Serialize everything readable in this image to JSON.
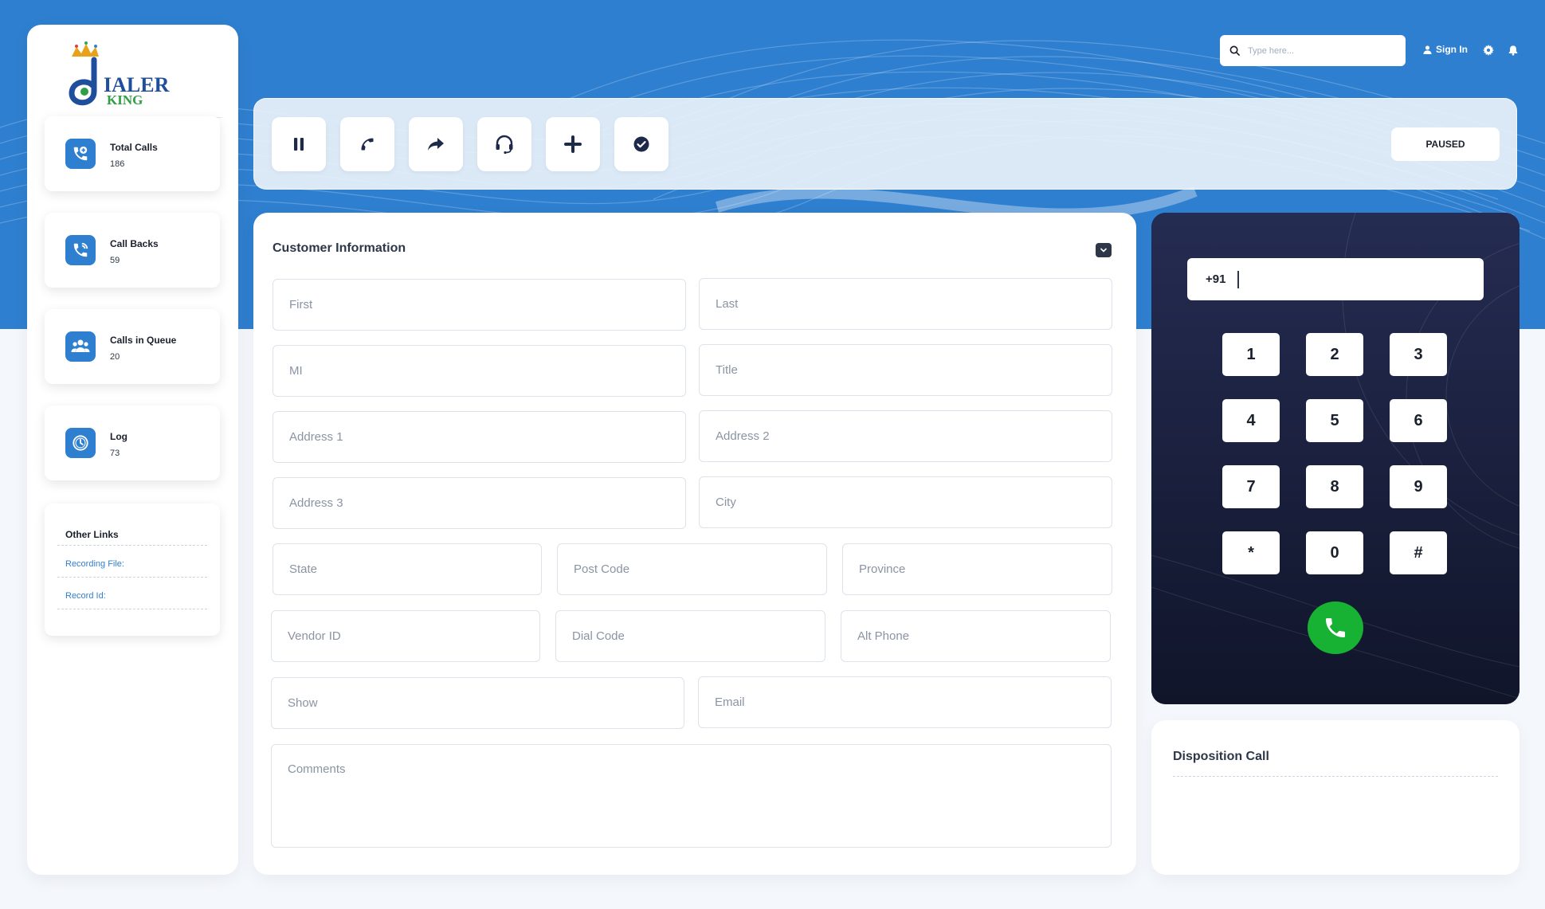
{
  "brand": {
    "logo_text_top": "IALER",
    "logo_text_bottom": "KING",
    "logo_letter": "D",
    "primary_color": "#2f7fd0",
    "call_color": "#17b233",
    "dialer_bg": "#1c2340"
  },
  "header": {
    "search_placeholder": "Type here...",
    "signin_label": "Sign In"
  },
  "sidebar": {
    "stats": [
      {
        "label": "Total Calls",
        "value": "186",
        "icon": "phone-plus-icon"
      },
      {
        "label": "Call Backs",
        "value": "59",
        "icon": "phone-callback-icon"
      },
      {
        "label": "Calls in Queue",
        "value": "20",
        "icon": "users-group-icon"
      },
      {
        "label": "Log",
        "value": "73",
        "icon": "clock-icon"
      }
    ],
    "other_links": {
      "title": "Other Links",
      "items": [
        "Recording File:",
        "Record Id:"
      ]
    }
  },
  "toolbar": {
    "buttons": [
      {
        "name": "pause",
        "icon": "pause-icon"
      },
      {
        "name": "call",
        "icon": "phone-icon"
      },
      {
        "name": "transfer",
        "icon": "forward-arrow-icon"
      },
      {
        "name": "headset",
        "icon": "headset-icon"
      },
      {
        "name": "add",
        "icon": "plus-icon"
      },
      {
        "name": "complete",
        "icon": "check-circle-icon"
      }
    ],
    "status": "PAUSED"
  },
  "customer": {
    "title": "Customer Information",
    "fields": {
      "first": "First",
      "last": "Last",
      "mi": "MI",
      "title": "Title",
      "address1": "Address 1",
      "address2": "Address 2",
      "address3": "Address 3",
      "city": "City",
      "state": "State",
      "post_code": "Post Code",
      "province": "Province",
      "vendor_id": "Vendor ID",
      "dial_code": "Dial Code",
      "alt_phone": "Alt Phone",
      "show": "Show",
      "email": "Email",
      "comments": "Comments"
    }
  },
  "dialer": {
    "country_code": "+91",
    "number": "",
    "keys": [
      "1",
      "2",
      "3",
      "4",
      "5",
      "6",
      "7",
      "8",
      "9",
      "*",
      "0",
      "#"
    ]
  },
  "disposition": {
    "title": "Disposition Call"
  }
}
